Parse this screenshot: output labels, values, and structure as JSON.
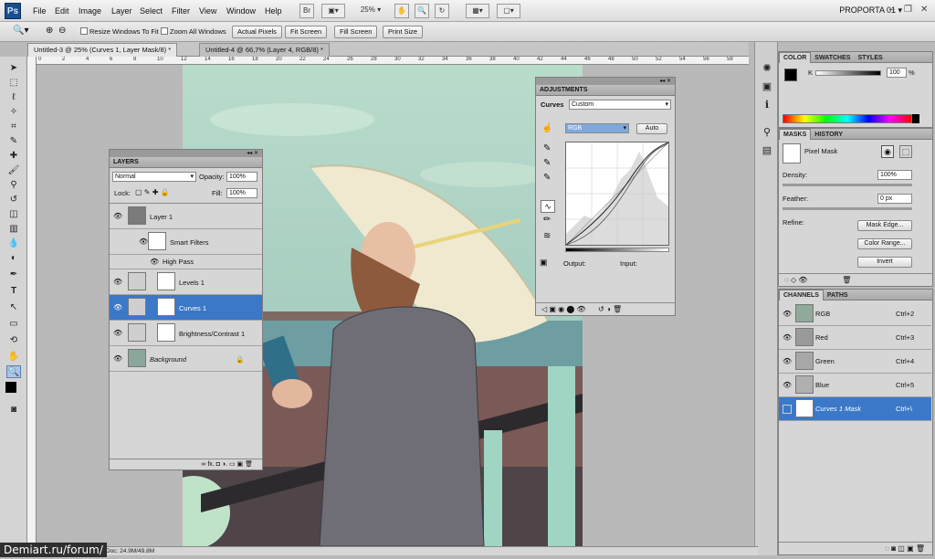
{
  "app": {
    "logo": "Ps",
    "workspace": "PROPORTA 01 ▾"
  },
  "menu": [
    "File",
    "Edit",
    "Image",
    "Layer",
    "Select",
    "Filter",
    "View",
    "Window",
    "Help"
  ],
  "menubar_icons": {
    "bridge": "Br",
    "zoom": "25%"
  },
  "options": {
    "resize": "Resize Windows To Fit",
    "zoom_all": "Zoom All Windows",
    "actual": "Actual Pixels",
    "fit": "Fit Screen",
    "fill": "Fill Screen",
    "print": "Print Size"
  },
  "tabs": [
    {
      "label": "Untitled-3 @ 25% (Curves 1, Layer Mask/8) *"
    },
    {
      "label": "Untitled-4 @ 66,7% (Layer 4, RGB/8) *"
    }
  ],
  "ruler": [
    "0",
    "2",
    "4",
    "6",
    "8",
    "10",
    "12",
    "14",
    "16",
    "18",
    "20",
    "22",
    "24",
    "26",
    "28",
    "30",
    "32",
    "34",
    "36",
    "38",
    "40",
    "42",
    "44",
    "46",
    "48",
    "50",
    "52",
    "54",
    "56",
    "58"
  ],
  "layers": {
    "title": "LAYERS",
    "blend": "Normal",
    "opacity_label": "Opacity:",
    "opacity": "100%",
    "lock_label": "Lock:",
    "fill_label": "Fill:",
    "fill": "100%",
    "rows": [
      {
        "name": "Layer 1"
      },
      {
        "name": "Smart Filters"
      },
      {
        "name": "High Pass"
      },
      {
        "name": "Levels 1"
      },
      {
        "name": "Curves 1"
      },
      {
        "name": "Brightness/Contrast 1"
      },
      {
        "name": "Background"
      }
    ],
    "footer": "∞  fx.  ◘  ◑.  ▭  ▣  🗑"
  },
  "adjustments": {
    "title": "ADJUSTMENTS",
    "label": "Curves",
    "preset": "Custom",
    "channel": "RGB",
    "auto": "Auto",
    "output": "Output:",
    "input": "Input:"
  },
  "color": {
    "tabs": [
      "COLOR",
      "SWATCHES",
      "STYLES"
    ],
    "k_label": "K",
    "k_value": "100",
    "k_unit": "%",
    "fg": "#000000",
    "bg": "#ffffff"
  },
  "masks": {
    "tabs": [
      "MASKS",
      "HISTORY"
    ],
    "pixel_mask": "Pixel Mask",
    "density_label": "Density:",
    "density": "100%",
    "feather_label": "Feather:",
    "feather": "0 px",
    "refine_label": "Refine:",
    "mask_edge": "Mask Edge...",
    "color_range": "Color Range...",
    "invert": "Invert"
  },
  "channels": {
    "tabs": [
      "CHANNELS",
      "PATHS"
    ],
    "rows": [
      {
        "name": "RGB",
        "shortcut": "Ctrl+2"
      },
      {
        "name": "Red",
        "shortcut": "Ctrl+3"
      },
      {
        "name": "Green",
        "shortcut": "Ctrl+4"
      },
      {
        "name": "Blue",
        "shortcut": "Ctrl+5"
      },
      {
        "name": "Curves 1 Mask",
        "shortcut": "Ctrl+\\"
      }
    ]
  },
  "status": {
    "doc": "Doc: 24.9M/49.8M"
  },
  "watermark": "Demiart.ru/forum/"
}
